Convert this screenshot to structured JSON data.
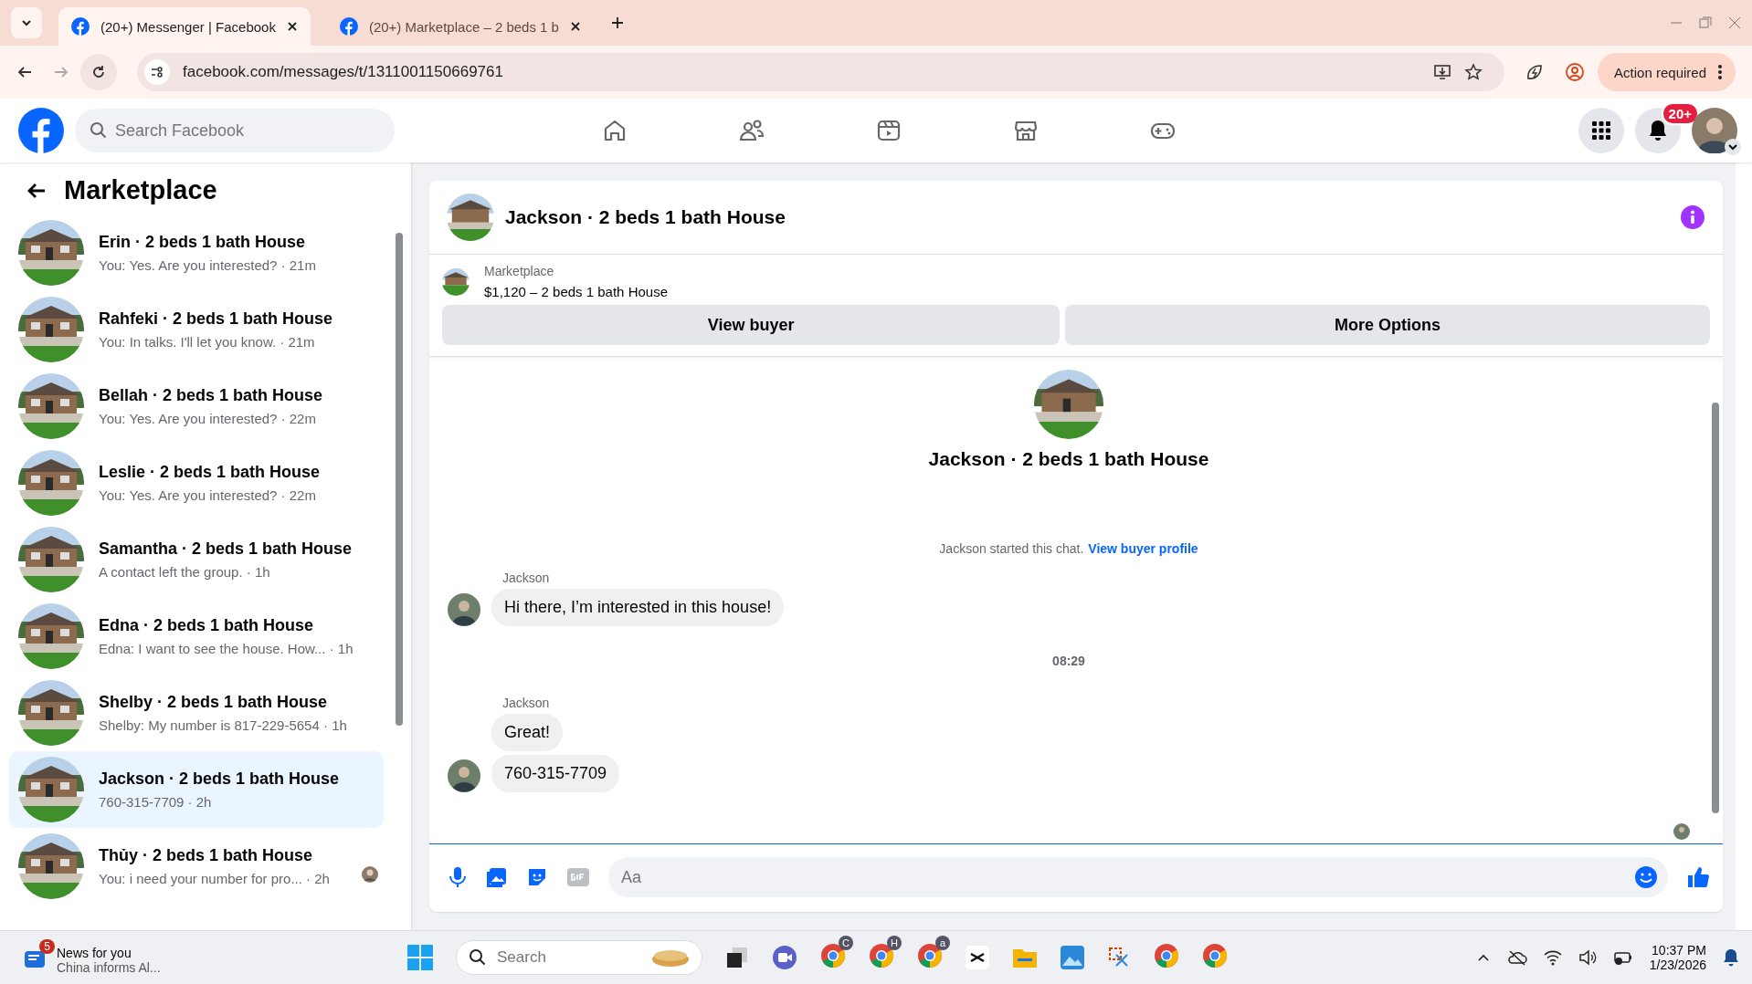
{
  "browser": {
    "tabs": [
      {
        "title": "(20+) Messenger | Facebook",
        "selected": true
      },
      {
        "title": "(20+) Marketplace – 2 beds 1 b",
        "selected": false
      }
    ],
    "url": "facebook.com/messages/t/1311001150669761",
    "action_button": "Action required"
  },
  "header": {
    "search_placeholder": "Search Facebook",
    "notification_badge": "20+"
  },
  "sidebar": {
    "title": "Marketplace",
    "conversations": [
      {
        "title": "Erin · 2 beds 1 bath House",
        "preview": "You: Yes. Are you interested? · 21m",
        "selected": false,
        "seen": false
      },
      {
        "title": "Rahfeki · 2 beds 1 bath House",
        "preview": "You: In talks. I'll let you know. · 21m",
        "selected": false,
        "seen": false
      },
      {
        "title": "Bellah · 2 beds 1 bath House",
        "preview": "You: Yes. Are you interested? · 22m",
        "selected": false,
        "seen": false
      },
      {
        "title": "Leslie · 2 beds 1 bath House",
        "preview": "You: Yes. Are you interested? · 22m",
        "selected": false,
        "seen": false
      },
      {
        "title": "Samantha · 2 beds 1 bath House",
        "preview": "A contact left the group. · 1h",
        "selected": false,
        "seen": false
      },
      {
        "title": "Edna · 2 beds 1 bath House",
        "preview": "Edna: I want to see the house. How... · 1h",
        "selected": false,
        "seen": false
      },
      {
        "title": "Shelby · 2 beds 1 bath House",
        "preview": "Shelby: My number is 817-229-5654 · 1h",
        "selected": false,
        "seen": false
      },
      {
        "title": "Jackson · 2 beds 1 bath House",
        "preview": "760-315-7709 · 2h",
        "selected": true,
        "seen": false
      },
      {
        "title": "Thủy · 2 beds 1 bath House",
        "preview": "You: i need your number for pro... · 2h",
        "selected": false,
        "seen": true
      }
    ]
  },
  "chat": {
    "title": "Jackson · 2 beds 1 bath House",
    "listing": {
      "source": "Marketplace",
      "summary": "$1,120 – 2 beds 1 bath House"
    },
    "buttons": [
      "View buyer",
      "More Options"
    ],
    "intro_title": "Jackson · 2 beds 1 bath House",
    "started_text": "Jackson started this chat.",
    "profile_link": "View buyer profile",
    "timeline": [
      {
        "kind": "group",
        "sender": "Jackson",
        "messages": [
          "Hi there, I’m interested in this house!"
        ]
      },
      {
        "kind": "time",
        "text": "08:29"
      },
      {
        "kind": "group",
        "sender": "Jackson",
        "messages": [
          "Great!",
          "760-315-7709"
        ]
      }
    ],
    "composer_placeholder": "Aa"
  },
  "taskbar": {
    "news_badge": "5",
    "news_title": "News for you",
    "news_subtitle": "China informs Al...",
    "search_placeholder": "Search",
    "app_badges": [
      "C",
      "H",
      "a"
    ],
    "time": "10:37 PM",
    "date": "1/23/2026"
  }
}
